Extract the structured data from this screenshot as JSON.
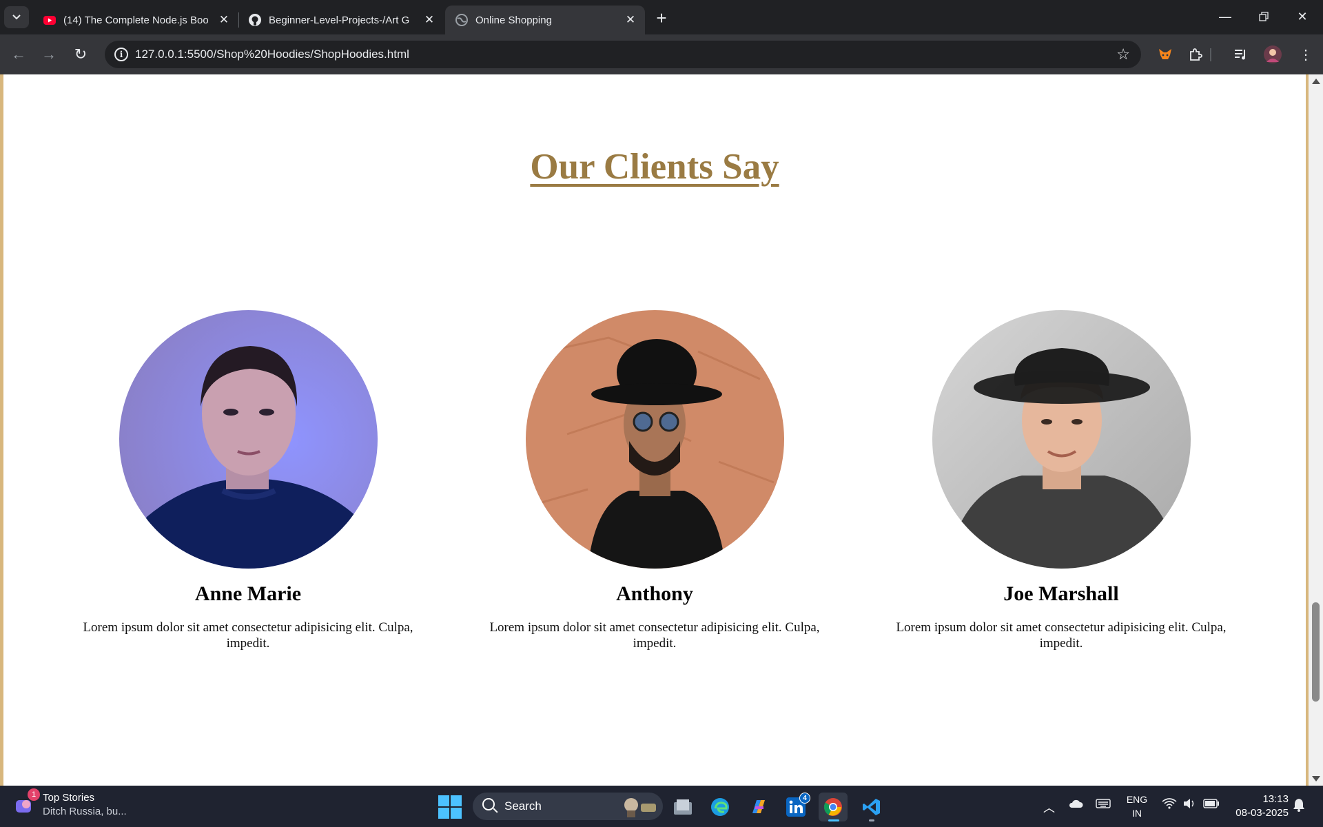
{
  "browser": {
    "tabs": [
      {
        "title": "(14) The Complete Node.js Boo",
        "favicon": "youtube-icon",
        "active": false
      },
      {
        "title": "Beginner-Level-Projects-/Art G",
        "favicon": "github-icon",
        "active": false
      },
      {
        "title": "Online Shopping",
        "favicon": "globe-icon",
        "active": true
      }
    ],
    "url": "127.0.0.1:5500/Shop%20Hoodies/ShopHoodies.html"
  },
  "page": {
    "accent_color": "#9a7b43",
    "border_color": "#d8b77d",
    "section_title": "Our Clients Say",
    "clients": [
      {
        "name": "Anne Marie",
        "quote": "Lorem ipsum dolor sit amet consectetur adipisicing elit. Culpa, impedit."
      },
      {
        "name": "Anthony",
        "quote": "Lorem ipsum dolor sit amet consectetur adipisicing elit. Culpa, impedit."
      },
      {
        "name": "Joe Marshall",
        "quote": "Lorem ipsum dolor sit amet consectetur adipisicing elit. Culpa, impedit."
      }
    ]
  },
  "taskbar": {
    "news_title": "Top Stories",
    "news_subtitle": "Ditch Russia, bu...",
    "news_badge": "1",
    "search_label": "Search",
    "linkedin_badge": "4",
    "language_line1": "ENG",
    "language_line2": "IN",
    "time": "13:13",
    "date": "08-03-2025"
  }
}
